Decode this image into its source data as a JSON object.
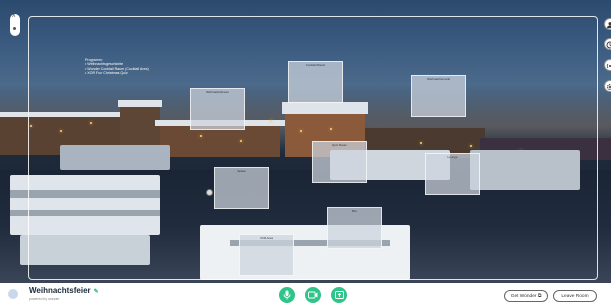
{
  "space": {
    "agenda_title": "Programm:",
    "agenda_items": [
      "Weihnachtsgeschichte",
      "Wonder Cocktail Raum (Cocktail Area)",
      "XOR Fun Christmas Quiz"
    ],
    "panels": [
      {
        "caption": "Weihnachtsbaum"
      },
      {
        "caption": "Cocktail Raum"
      },
      {
        "caption": "Weihnachtsmarkt"
      },
      {
        "caption": "Quiz Raum"
      },
      {
        "caption": "Lounge"
      },
      {
        "caption": "Spiele"
      },
      {
        "caption": "Bar"
      },
      {
        "caption": "Chill Area"
      }
    ]
  },
  "room": {
    "title": "Weihnachtsfeier",
    "powered_by": "powered by wonder"
  },
  "controls": {
    "get_wonder_label": "Get Wonder",
    "leave_room_label": "Leave Room"
  },
  "icons": {
    "mic": "microphone-icon",
    "cam": "camera-icon",
    "share": "screen-share-icon",
    "people": "people-icon",
    "clock": "clock-icon",
    "broadcast": "broadcast-icon",
    "settings": "gear-icon"
  },
  "colors": {
    "accent": "#2fc48a"
  }
}
